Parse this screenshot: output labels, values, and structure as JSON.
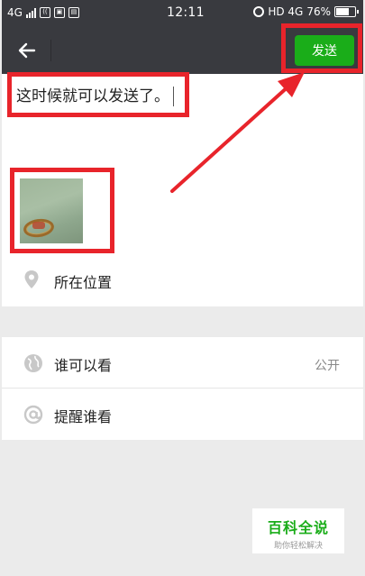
{
  "status_bar": {
    "network_left": "4G",
    "time": "12:11",
    "network_right": "HD 4G",
    "battery": "76%",
    "battery_level": 0.76,
    "icons": [
      "signal-icon",
      "wifi-calling-icon",
      "notification-icon",
      "alarm-icon",
      "battery-icon"
    ]
  },
  "app_bar": {
    "back_icon": "back-arrow-icon",
    "send_label": "发送",
    "accent_color": "#1aad19"
  },
  "compose": {
    "text": "这时候就可以发送了。"
  },
  "location": {
    "icon": "location-pin-icon",
    "label": "所在位置"
  },
  "settings": [
    {
      "icon": "globe-icon",
      "label": "谁可以看",
      "value": "公开"
    },
    {
      "icon": "at-sign-icon",
      "label": "提醒谁看"
    }
  ],
  "watermark": {
    "main": "百科全说",
    "sub": "助你轻松解决"
  },
  "annotation_color": "#e8242b"
}
